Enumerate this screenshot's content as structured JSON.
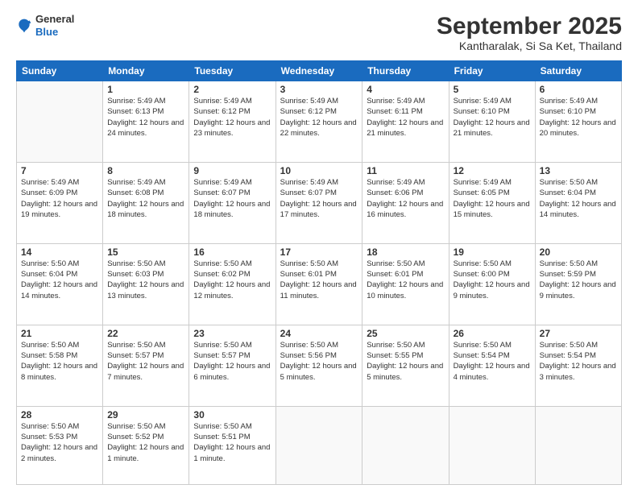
{
  "logo": {
    "general": "General",
    "blue": "Blue"
  },
  "title": "September 2025",
  "subtitle": "Kantharalak, Si Sa Ket, Thailand",
  "days_of_week": [
    "Sunday",
    "Monday",
    "Tuesday",
    "Wednesday",
    "Thursday",
    "Friday",
    "Saturday"
  ],
  "weeks": [
    [
      {
        "day": "",
        "info": ""
      },
      {
        "day": "1",
        "info": "Sunrise: 5:49 AM\nSunset: 6:13 PM\nDaylight: 12 hours\nand 24 minutes."
      },
      {
        "day": "2",
        "info": "Sunrise: 5:49 AM\nSunset: 6:12 PM\nDaylight: 12 hours\nand 23 minutes."
      },
      {
        "day": "3",
        "info": "Sunrise: 5:49 AM\nSunset: 6:12 PM\nDaylight: 12 hours\nand 22 minutes."
      },
      {
        "day": "4",
        "info": "Sunrise: 5:49 AM\nSunset: 6:11 PM\nDaylight: 12 hours\nand 21 minutes."
      },
      {
        "day": "5",
        "info": "Sunrise: 5:49 AM\nSunset: 6:10 PM\nDaylight: 12 hours\nand 21 minutes."
      },
      {
        "day": "6",
        "info": "Sunrise: 5:49 AM\nSunset: 6:10 PM\nDaylight: 12 hours\nand 20 minutes."
      }
    ],
    [
      {
        "day": "7",
        "info": "Sunrise: 5:49 AM\nSunset: 6:09 PM\nDaylight: 12 hours\nand 19 minutes."
      },
      {
        "day": "8",
        "info": "Sunrise: 5:49 AM\nSunset: 6:08 PM\nDaylight: 12 hours\nand 18 minutes."
      },
      {
        "day": "9",
        "info": "Sunrise: 5:49 AM\nSunset: 6:07 PM\nDaylight: 12 hours\nand 18 minutes."
      },
      {
        "day": "10",
        "info": "Sunrise: 5:49 AM\nSunset: 6:07 PM\nDaylight: 12 hours\nand 17 minutes."
      },
      {
        "day": "11",
        "info": "Sunrise: 5:49 AM\nSunset: 6:06 PM\nDaylight: 12 hours\nand 16 minutes."
      },
      {
        "day": "12",
        "info": "Sunrise: 5:49 AM\nSunset: 6:05 PM\nDaylight: 12 hours\nand 15 minutes."
      },
      {
        "day": "13",
        "info": "Sunrise: 5:50 AM\nSunset: 6:04 PM\nDaylight: 12 hours\nand 14 minutes."
      }
    ],
    [
      {
        "day": "14",
        "info": "Sunrise: 5:50 AM\nSunset: 6:04 PM\nDaylight: 12 hours\nand 14 minutes."
      },
      {
        "day": "15",
        "info": "Sunrise: 5:50 AM\nSunset: 6:03 PM\nDaylight: 12 hours\nand 13 minutes."
      },
      {
        "day": "16",
        "info": "Sunrise: 5:50 AM\nSunset: 6:02 PM\nDaylight: 12 hours\nand 12 minutes."
      },
      {
        "day": "17",
        "info": "Sunrise: 5:50 AM\nSunset: 6:01 PM\nDaylight: 12 hours\nand 11 minutes."
      },
      {
        "day": "18",
        "info": "Sunrise: 5:50 AM\nSunset: 6:01 PM\nDaylight: 12 hours\nand 10 minutes."
      },
      {
        "day": "19",
        "info": "Sunrise: 5:50 AM\nSunset: 6:00 PM\nDaylight: 12 hours\nand 9 minutes."
      },
      {
        "day": "20",
        "info": "Sunrise: 5:50 AM\nSunset: 5:59 PM\nDaylight: 12 hours\nand 9 minutes."
      }
    ],
    [
      {
        "day": "21",
        "info": "Sunrise: 5:50 AM\nSunset: 5:58 PM\nDaylight: 12 hours\nand 8 minutes."
      },
      {
        "day": "22",
        "info": "Sunrise: 5:50 AM\nSunset: 5:57 PM\nDaylight: 12 hours\nand 7 minutes."
      },
      {
        "day": "23",
        "info": "Sunrise: 5:50 AM\nSunset: 5:57 PM\nDaylight: 12 hours\nand 6 minutes."
      },
      {
        "day": "24",
        "info": "Sunrise: 5:50 AM\nSunset: 5:56 PM\nDaylight: 12 hours\nand 5 minutes."
      },
      {
        "day": "25",
        "info": "Sunrise: 5:50 AM\nSunset: 5:55 PM\nDaylight: 12 hours\nand 5 minutes."
      },
      {
        "day": "26",
        "info": "Sunrise: 5:50 AM\nSunset: 5:54 PM\nDaylight: 12 hours\nand 4 minutes."
      },
      {
        "day": "27",
        "info": "Sunrise: 5:50 AM\nSunset: 5:54 PM\nDaylight: 12 hours\nand 3 minutes."
      }
    ],
    [
      {
        "day": "28",
        "info": "Sunrise: 5:50 AM\nSunset: 5:53 PM\nDaylight: 12 hours\nand 2 minutes."
      },
      {
        "day": "29",
        "info": "Sunrise: 5:50 AM\nSunset: 5:52 PM\nDaylight: 12 hours\nand 1 minute."
      },
      {
        "day": "30",
        "info": "Sunrise: 5:50 AM\nSunset: 5:51 PM\nDaylight: 12 hours\nand 1 minute."
      },
      {
        "day": "",
        "info": ""
      },
      {
        "day": "",
        "info": ""
      },
      {
        "day": "",
        "info": ""
      },
      {
        "day": "",
        "info": ""
      }
    ]
  ]
}
